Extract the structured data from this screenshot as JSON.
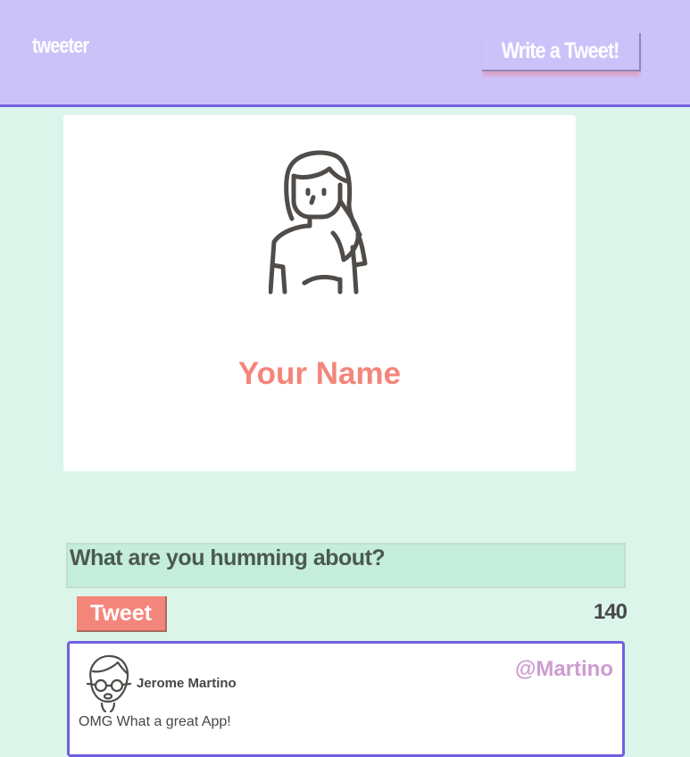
{
  "header": {
    "brand": "tweeter",
    "write_button_label": "Write a Tweet!"
  },
  "profile": {
    "name": "Your Name",
    "avatar_icon": "woman-avatar-icon"
  },
  "composer": {
    "placeholder": "What are you humming about?",
    "value": "",
    "tweet_button_label": "Tweet",
    "char_counter": "140"
  },
  "tweets": [
    {
      "name": "Jerome Martino",
      "handle": "@Martino",
      "text": "OMG What a great App!",
      "avatar_icon": "man-with-glasses-avatar-icon"
    }
  ],
  "colors": {
    "header_bg": "#ccc2fa",
    "accent_border": "#6f60e0",
    "page_bg": "#dcf5ea",
    "name_color": "#f4857b",
    "handle_color": "#cd9cd0",
    "tweet_button_bg": "#f4857b",
    "composer_bg": "#c4eedb"
  }
}
